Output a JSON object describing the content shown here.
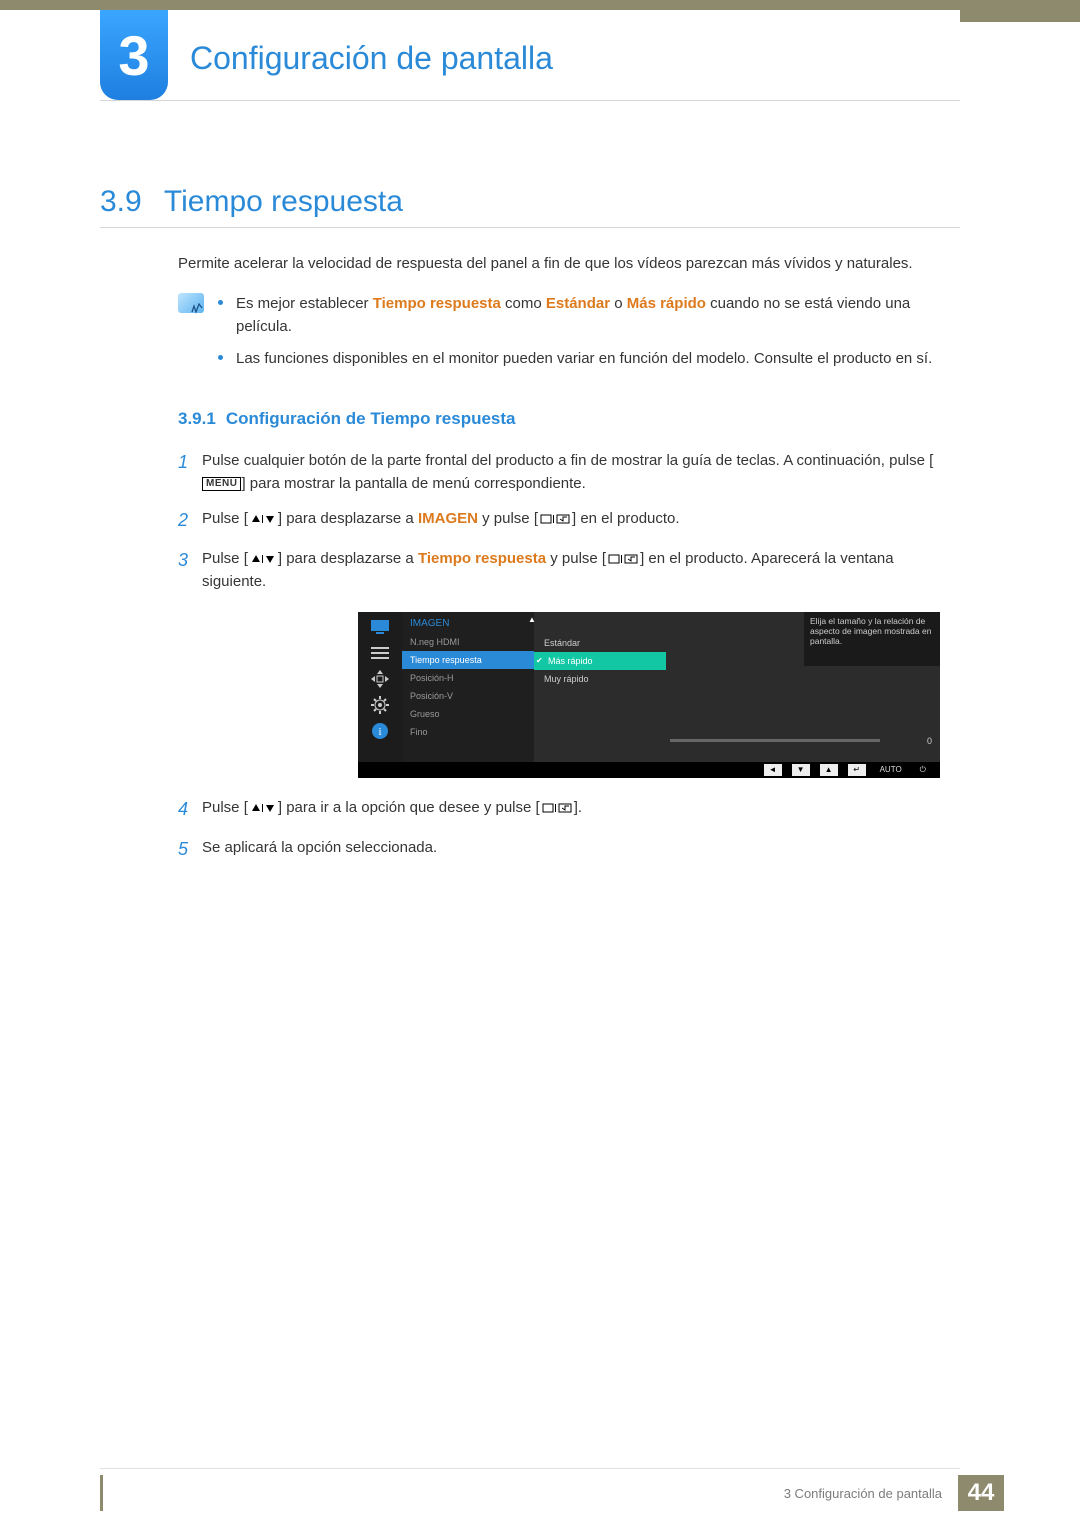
{
  "chapter": {
    "number": "3",
    "title": "Configuración de pantalla"
  },
  "section": {
    "number": "3.9",
    "title": "Tiempo respuesta"
  },
  "intro": "Permite acelerar la velocidad de respuesta del panel a fin de que los vídeos parezcan más vívidos y naturales.",
  "notes": {
    "item1_pre": "Es mejor establecer ",
    "item1_kw1": "Tiempo respuesta",
    "item1_mid1": " como ",
    "item1_kw2": "Estándar",
    "item1_mid2": " o ",
    "item1_kw3": "Más rápido",
    "item1_post": " cuando no se está viendo una película.",
    "item2": "Las funciones disponibles en el monitor pueden variar en función del modelo. Consulte el producto en sí."
  },
  "subsection": {
    "number": "3.9.1",
    "title": "Configuración de Tiempo respuesta"
  },
  "steps": {
    "s1_a": "Pulse cualquier botón de la parte frontal del producto a fin de mostrar la guía de teclas. A continuación, pulse [",
    "s1_menu": "MENU",
    "s1_b": "] para mostrar la pantalla de menú correspondiente.",
    "s2_a": "Pulse [",
    "s2_b": "] para desplazarse a ",
    "s2_kw": "IMAGEN",
    "s2_c": " y pulse [",
    "s2_d": "] en el producto.",
    "s3_a": "Pulse [",
    "s3_b": "] para desplazarse a ",
    "s3_kw": "Tiempo respuesta",
    "s3_c": " y pulse [",
    "s3_d": "] en el producto. Aparecerá la ventana siguiente.",
    "s4_a": "Pulse [",
    "s4_b": "] para ir a la opción que desee y pulse [",
    "s4_c": "].",
    "s5": "Se aplicará la opción seleccionada."
  },
  "step_numbers": {
    "n1": "1",
    "n2": "2",
    "n3": "3",
    "n4": "4",
    "n5": "5"
  },
  "osd": {
    "col1_title": "IMAGEN",
    "col1_items": [
      "N.neg HDMI",
      "Tiempo respuesta",
      "Posición-H",
      "Posición-V",
      "Grueso",
      "Fino"
    ],
    "col1_selected_index": 1,
    "col2_items": [
      "Estándar",
      "Más rápido",
      "Muy rápido"
    ],
    "col2_selected_index": 1,
    "info_text": "Elija el tamaño y la relación de aspecto de imagen mostrada en pantalla.",
    "slider_value": "0",
    "footer_auto": "AUTO"
  },
  "footer": {
    "text": "3 Configuración de pantalla",
    "page": "44"
  }
}
